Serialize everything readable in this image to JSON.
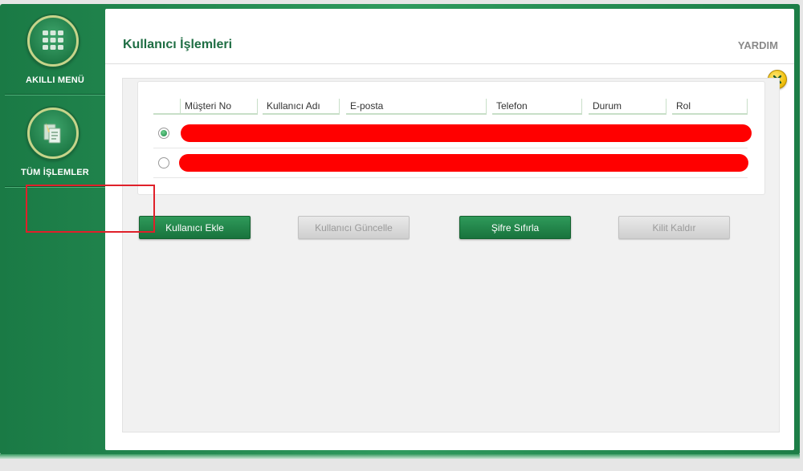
{
  "sidebar": {
    "items": [
      {
        "label": "AKILLI MENÜ",
        "icon": "grid-menu-icon"
      },
      {
        "label": "TÜM İŞLEMLER",
        "icon": "documents-icon"
      }
    ]
  },
  "header": {
    "title": "Kullanıcı İşlemleri",
    "help": "YARDIM"
  },
  "table": {
    "columns": [
      "Müşteri No",
      "Kullanıcı Adı",
      "E-posta",
      "Telefon",
      "Durum",
      "Rol"
    ],
    "rows": [
      {
        "selected": true
      },
      {
        "selected": false
      }
    ]
  },
  "actions": {
    "add_user": "Kullanıcı Ekle",
    "update_user": "Kullanıcı Güncelle",
    "reset_password": "Şifre Sıfırla",
    "unlock": "Kilit Kaldır"
  },
  "colors": {
    "brand_green": "#1f7b47",
    "title_green": "#1f6e44",
    "highlight_red": "#e0202a",
    "redaction": "#ff0000",
    "close_yellow": "#f2c20f"
  }
}
